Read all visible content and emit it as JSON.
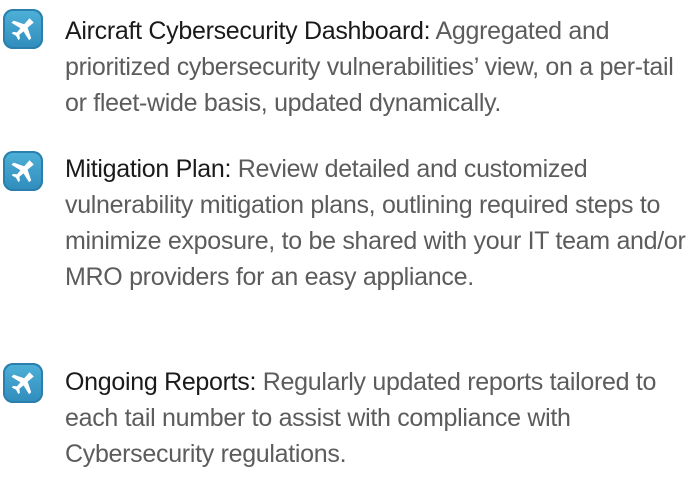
{
  "features": [
    {
      "icon": "airplane-icon",
      "title": "Aircraft Cybersecurity Dashboard:",
      "description": " Aggregated and prioritized cybersecurity vulnerabilities’ view, on a per-tail or fleet-wide basis, updated dynamically."
    },
    {
      "icon": "airplane-icon",
      "title": "Mitigation Plan:",
      "description": " Review detailed and customized vulnerability mitigation plans, outlining required steps to minimize exposure, to be shared with your IT team and/or MRO providers for an easy appliance."
    },
    {
      "icon": "airplane-icon",
      "title": "Ongoing Reports:",
      "description": " Regularly updated reports tailored to each tail number to assist with compliance with Cybersecurity regulations."
    }
  ],
  "colors": {
    "icon_background": "#3a9dcb",
    "title_text": "#1a1a1a",
    "body_text": "#5c5c5c"
  }
}
